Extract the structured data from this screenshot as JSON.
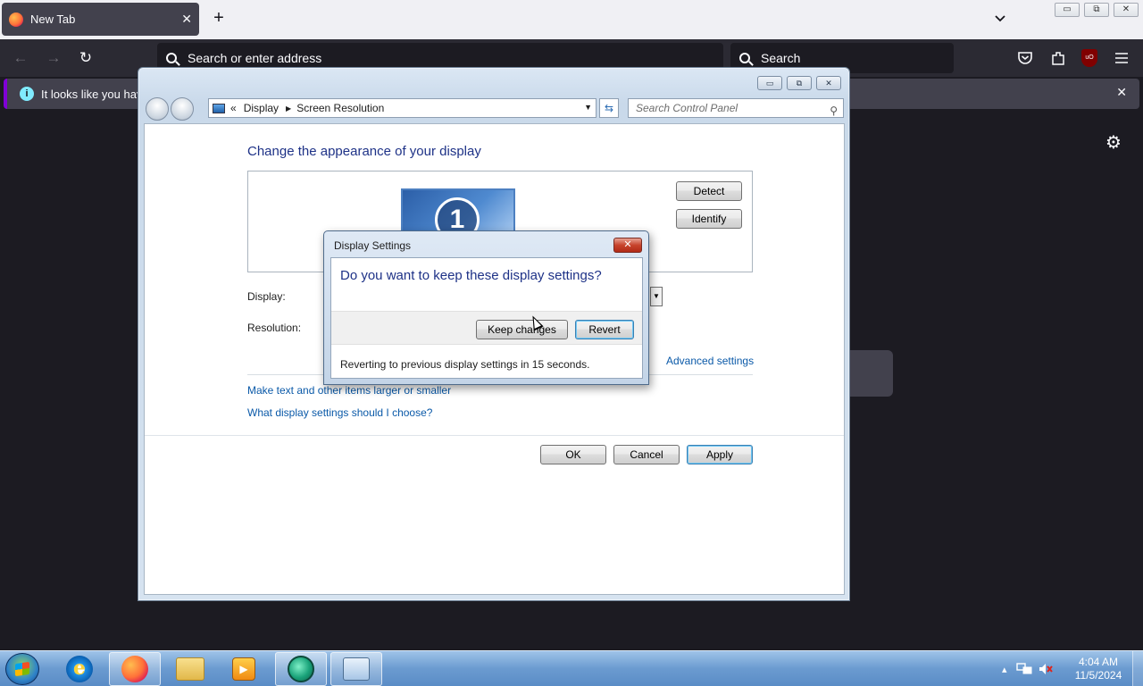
{
  "browser": {
    "tab_title": "New Tab",
    "tab_close": "✕",
    "new_tab": "+",
    "url_placeholder": "Search or enter address",
    "search_placeholder": "Search",
    "notification_text": "It looks like you have",
    "notification_close": "✕",
    "ublock_label": "uO"
  },
  "window_controls": {
    "minimize": "▭",
    "restore": "⧉",
    "close": "✕"
  },
  "control_panel": {
    "breadcrumb_prefix": "«",
    "breadcrumb": [
      "Display",
      "Screen Resolution"
    ],
    "search_placeholder": "Search Control Panel",
    "heading": "Change the appearance of your display",
    "monitor_number": "1",
    "detect_button": "Detect",
    "identify_button": "Identify",
    "display_label": "Display:",
    "resolution_label": "Resolution:",
    "advanced_link": "Advanced settings",
    "link_text_size": "Make text and other items larger or smaller",
    "link_help": "What display settings should I choose?",
    "ok_button": "OK",
    "cancel_button": "Cancel",
    "apply_button": "Apply"
  },
  "dialog": {
    "title": "Display Settings",
    "close": "✕",
    "question": "Do you want to keep these display settings?",
    "keep_button": "Keep changes",
    "revert_button": "Revert",
    "status": "Reverting to previous display settings in 15 seconds."
  },
  "taskbar": {
    "ie_glyph": "e",
    "media_glyph": "▶",
    "tray_arrow": "▴",
    "time": "4:04 AM",
    "date": "11/5/2024"
  }
}
